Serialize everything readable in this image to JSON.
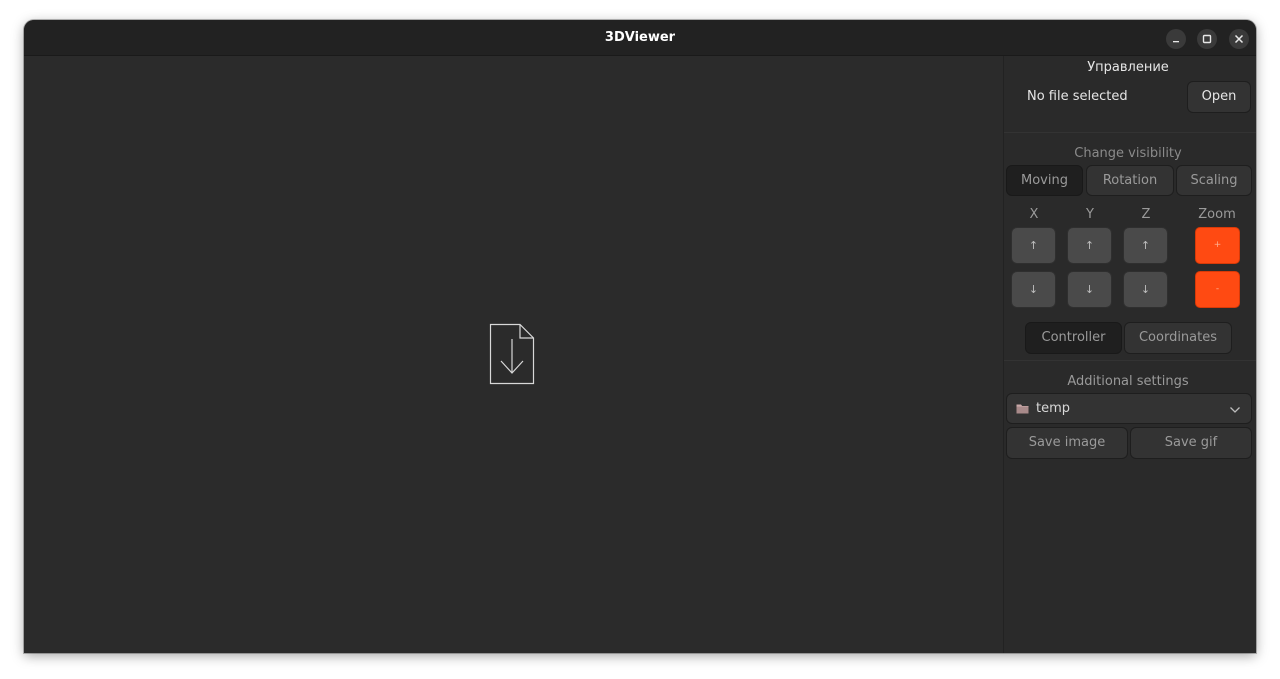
{
  "window": {
    "title": "3DViewer"
  },
  "panel": {
    "header": "Управление",
    "file_status": "No file selected",
    "open_label": "Open",
    "visibility_label": "Change visibility",
    "mode_tabs": [
      "Moving",
      "Rotation",
      "Scaling"
    ],
    "axes": [
      "X",
      "Y",
      "Z"
    ],
    "zoom_label": "Zoom",
    "up_glyph": "↑",
    "down_glyph": "↓",
    "zoom_in_glyph": "+",
    "zoom_out_glyph": "-",
    "view_tabs": [
      "Controller",
      "Coordinates"
    ],
    "additional_label": "Additional settings",
    "folder": {
      "value": "temp",
      "icon": "folder-icon"
    },
    "save_image_label": "Save image",
    "save_gif_label": "Save gif"
  },
  "colors": {
    "accent": "#ff4a12",
    "window_bg": "#2b2b2b",
    "titlebar_bg": "#222222"
  }
}
